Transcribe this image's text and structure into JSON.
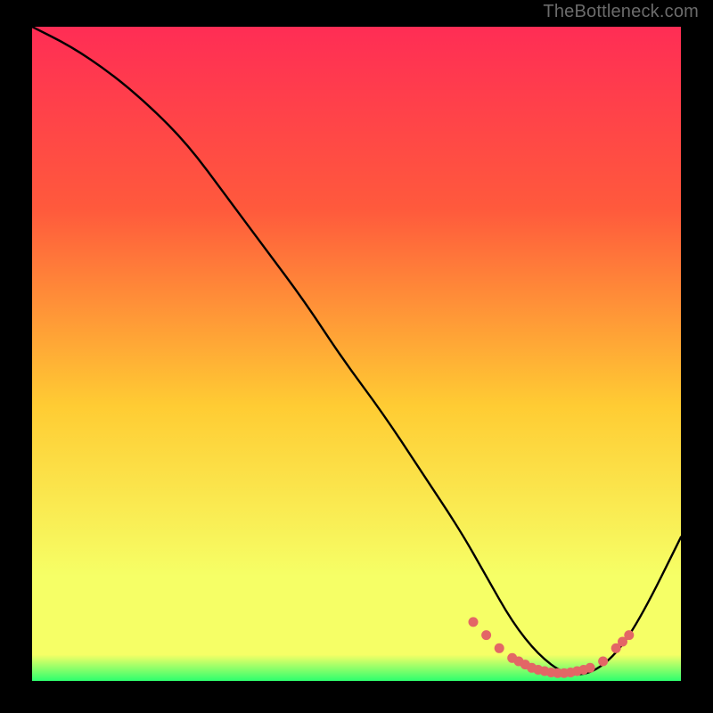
{
  "attribution": "TheBottleneck.com",
  "colors": {
    "black": "#000000",
    "text": "#6b6b6b",
    "grad_top": "#ff2d55",
    "grad_upper": "#ff5a3c",
    "grad_mid": "#ffcc33",
    "grad_low": "#f6ff66",
    "grad_green": "#2dff6e",
    "curve": "#000000",
    "dot": "#e36666"
  },
  "chart_data": {
    "type": "line",
    "title": "",
    "xlabel": "",
    "ylabel": "",
    "xlim": [
      0,
      100
    ],
    "ylim": [
      0,
      100
    ],
    "series": [
      {
        "name": "bottleneck-curve",
        "x": [
          0,
          6,
          12,
          18,
          24,
          30,
          36,
          42,
          48,
          54,
          60,
          66,
          70,
          74,
          78,
          82,
          86,
          90,
          94,
          100
        ],
        "y": [
          100,
          97,
          93,
          88,
          82,
          74,
          66,
          58,
          49,
          41,
          32,
          23,
          16,
          9,
          4,
          1,
          1,
          4,
          10,
          22
        ]
      }
    ],
    "scatter": {
      "name": "sample-dots",
      "x": [
        68,
        70,
        72,
        74,
        75,
        76,
        77,
        78,
        79,
        80,
        81,
        82,
        83,
        84,
        85,
        86,
        88,
        90,
        91,
        92
      ],
      "y": [
        9,
        7,
        5,
        3.5,
        3,
        2.5,
        2,
        1.7,
        1.5,
        1.3,
        1.2,
        1.2,
        1.3,
        1.5,
        1.7,
        2.0,
        3.0,
        5.0,
        6.0,
        7.0
      ]
    }
  }
}
